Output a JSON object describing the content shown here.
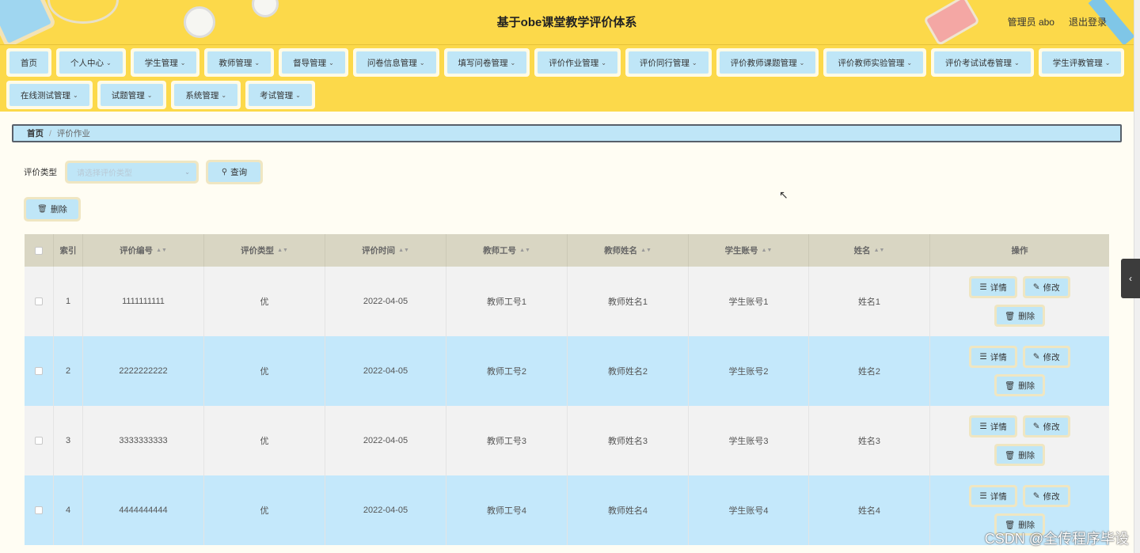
{
  "header": {
    "title": "基于obe课堂教学评价体系",
    "user": "管理员 abo",
    "logout": "退出登录"
  },
  "nav": {
    "row1": [
      {
        "label": "首页",
        "caret": false
      },
      {
        "label": "个人中心",
        "caret": true
      },
      {
        "label": "学生管理",
        "caret": true
      },
      {
        "label": "教师管理",
        "caret": true
      },
      {
        "label": "督导管理",
        "caret": true
      },
      {
        "label": "问卷信息管理",
        "caret": true
      },
      {
        "label": "填写问卷管理",
        "caret": true
      },
      {
        "label": "评价作业管理",
        "caret": true
      },
      {
        "label": "评价同行管理",
        "caret": true
      },
      {
        "label": "评价教师课题管理",
        "caret": true
      },
      {
        "label": "评价教师实验管理",
        "caret": true
      },
      {
        "label": "评价考试试卷管理",
        "caret": true
      },
      {
        "label": "学生评教管理",
        "caret": true
      }
    ],
    "row2": [
      {
        "label": "在线测试管理",
        "caret": true
      },
      {
        "label": "试题管理",
        "caret": true
      },
      {
        "label": "系统管理",
        "caret": true
      },
      {
        "label": "考试管理",
        "caret": true
      }
    ]
  },
  "breadcrumb": {
    "home": "首页",
    "sep": "/",
    "current": "评价作业"
  },
  "search": {
    "label": "评价类型",
    "placeholder": "请选择评价类型",
    "query_button": "查询",
    "delete_button": "删除"
  },
  "table": {
    "headers": [
      "索引",
      "评价编号",
      "评价类型",
      "评价时间",
      "教师工号",
      "教师姓名",
      "学生账号",
      "姓名",
      "操作"
    ],
    "rows": [
      {
        "index": "1",
        "code": "1111111111",
        "type": "优",
        "time": "2022-04-05",
        "teacher_id": "教师工号1",
        "teacher_name": "教师姓名1",
        "student_account": "学生账号1",
        "name": "姓名1"
      },
      {
        "index": "2",
        "code": "2222222222",
        "type": "优",
        "time": "2022-04-05",
        "teacher_id": "教师工号2",
        "teacher_name": "教师姓名2",
        "student_account": "学生账号2",
        "name": "姓名2"
      },
      {
        "index": "3",
        "code": "3333333333",
        "type": "优",
        "time": "2022-04-05",
        "teacher_id": "教师工号3",
        "teacher_name": "教师姓名3",
        "student_account": "学生账号3",
        "name": "姓名3"
      },
      {
        "index": "4",
        "code": "4444444444",
        "type": "优",
        "time": "2022-04-05",
        "teacher_id": "教师工号4",
        "teacher_name": "教师姓名4",
        "student_account": "学生账号4",
        "name": "姓名4"
      }
    ],
    "actions": {
      "detail": "详情",
      "edit": "修改",
      "delete": "删除"
    }
  },
  "watermark": "CSDN @全传程序毕设",
  "colors": {
    "header_bg": "#fcd94a",
    "button_bg": "#bfe6f7",
    "button_border": "#efe6c2",
    "row_alt": "#c4e8fb",
    "table_head": "#d9d6c3"
  }
}
